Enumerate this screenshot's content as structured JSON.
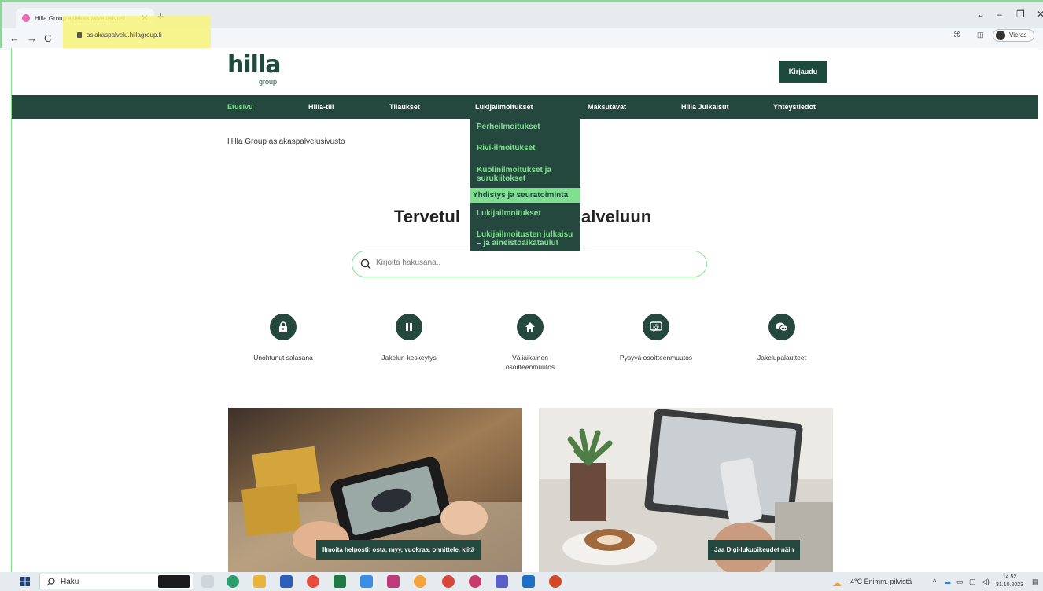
{
  "browser": {
    "tab_title": "Hilla Group asiakaspalvelusivust",
    "url": "asiakaspalvelu.hillagroup.fi",
    "profile_label": "Vieras"
  },
  "header": {
    "logo_main": "hilla",
    "logo_sub": "group",
    "login_label": "Kirjaudu"
  },
  "nav": {
    "items": [
      "Etusivu",
      "Hilla-tili",
      "Tilaukset",
      "Lukijailmoitukset",
      "Maksutavat",
      "Hilla Julkaisut",
      "Yhteystiedot"
    ],
    "active_index": 0
  },
  "dropdown": {
    "items": [
      "Perheilmoitukset",
      "Rivi-ilmoitukset",
      "Kuolinilmoitukset ja surukiitokset",
      "Yhdistys ja seuratoiminta",
      "Lukijailmoitukset",
      "Lukijailmoitusten julkaisu – ja aineistoaikataulut"
    ],
    "hover_index": 3
  },
  "main": {
    "breadcrumb": "Hilla Group asiakaspalvelusivusto",
    "hero_title_left": "Tervetul",
    "hero_title_right": "alveluun",
    "search_placeholder": "Kirjoita hakusana.."
  },
  "quick_actions": [
    {
      "label": "Unohtunut salasana",
      "icon": "lock-icon"
    },
    {
      "label": "Jakelun-keskeytys",
      "icon": "pause-icon"
    },
    {
      "label": "Väliaikainen osoitteenmuutos",
      "icon": "home-icon"
    },
    {
      "label": "Pysyvä osoitteenmuutos",
      "icon": "at-sign-icon"
    },
    {
      "label": "Jakelupalautteet",
      "icon": "chat-icon"
    }
  ],
  "cards": [
    {
      "badge": "Ilmoita helposti: osta, myy, vuokraa, onnittele, kiitä"
    },
    {
      "badge": "Jaa Digi-lukuoikeudet näin"
    }
  ],
  "taskbar": {
    "search_label": "Haku",
    "weather": "-4°C  Enimm. pilvistä",
    "time": "14.52",
    "date": "31.10.2023"
  },
  "colors": {
    "brand_dark": "#24483d",
    "brand_accent": "#7ee08f"
  }
}
